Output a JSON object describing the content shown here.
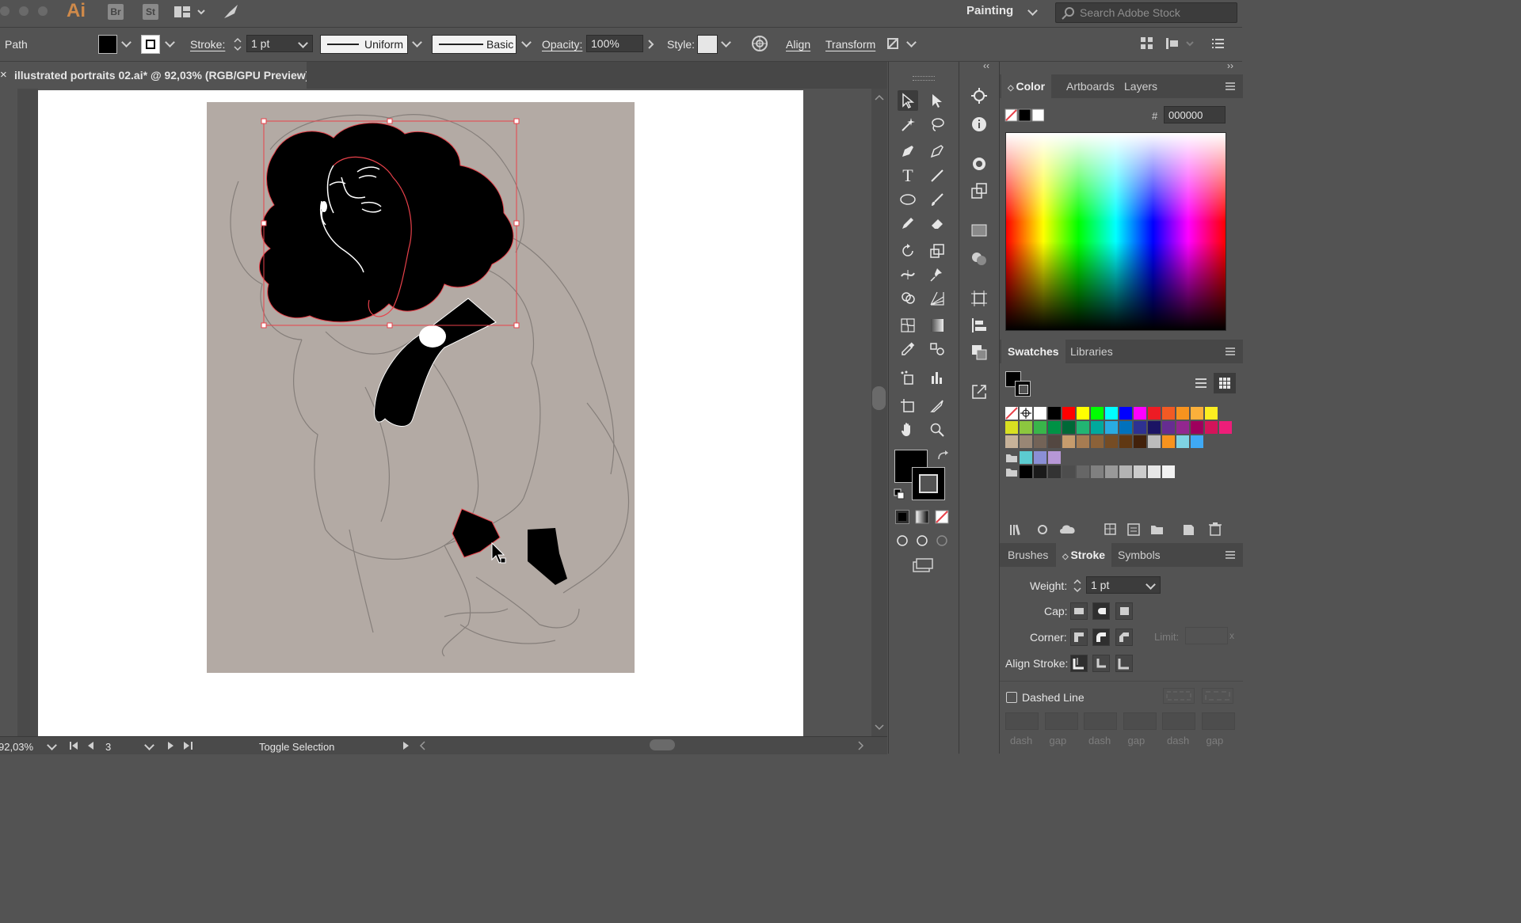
{
  "appbar": {
    "app_logo": "Ai",
    "bridge_label": "Br",
    "stock_label": "St",
    "workspace": "Painting",
    "search_placeholder": "Search Adobe Stock"
  },
  "control_bar": {
    "object_type": "Path",
    "stroke_label": "Stroke:",
    "stroke_weight": "1 pt",
    "profile": "Uniform",
    "brush": "Basic",
    "opacity_label": "Opacity:",
    "opacity_value": "100%",
    "style_label": "Style:",
    "align_label": "Align",
    "transform_label": "Transform"
  },
  "document": {
    "tab_title": "illustrated portraits 02.ai* @ 92,03% (RGB/GPU Preview)"
  },
  "status_bar": {
    "zoom": "92,03%",
    "artboard_number": "3",
    "status_text": "Toggle Selection"
  },
  "color_panel": {
    "tabs": [
      "Color",
      "Artboards",
      "Layers"
    ],
    "hex_label": "#",
    "hex_value": "000000"
  },
  "swatches_panel": {
    "tabs": [
      "Swatches",
      "Libraries"
    ],
    "row1": [
      "#ffffff",
      "#000000",
      "#ff0000",
      "#ffff00",
      "#00ff00",
      "#00ffff",
      "#0000ff",
      "#ff00ff",
      "#ed1c24",
      "#f15a24",
      "#f7931e",
      "#fbb03b",
      "#fcee21"
    ],
    "row2": [
      "#d9e021",
      "#8cc63f",
      "#39b54a",
      "#009245",
      "#006837",
      "#22b573",
      "#00a99d",
      "#29abe2",
      "#0071bc",
      "#2e3192",
      "#1b1464",
      "#662d91",
      "#93278f",
      "#9e005d",
      "#d4145a",
      "#ed1e79"
    ],
    "row3": [
      "#c7b299",
      "#998675",
      "#736357",
      "#534741",
      "#c69c6d",
      "#a67c52",
      "#8c6239",
      "#754c24",
      "#603813",
      "#42210b",
      "#bcbcbc",
      "#f7931e",
      "#7fd3e3",
      "#3fa9f5"
    ],
    "row4": [
      "#5ccbd0",
      "#8b8fd6",
      "#b697d6"
    ],
    "row5": [
      "#000000",
      "#1a1a1a",
      "#333333",
      "#4d4d4d",
      "#666666",
      "#808080",
      "#999999",
      "#b3b3b3",
      "#cccccc",
      "#e6e6e6",
      "#f2f2f2"
    ]
  },
  "stroke_panel": {
    "tabs": [
      "Brushes",
      "Stroke",
      "Symbols"
    ],
    "weight_label": "Weight:",
    "weight_value": "1 pt",
    "cap_label": "Cap:",
    "corner_label": "Corner:",
    "limit_label": "Limit:",
    "align_stroke_label": "Align Stroke:",
    "dashed_line_label": "Dashed Line",
    "dash_gap_labels": [
      "dash",
      "gap",
      "dash",
      "gap",
      "dash",
      "gap"
    ]
  },
  "colors": {
    "ui_background": "#535353",
    "selection_red": "#e8414a",
    "photo_background": "#b3aaa4"
  }
}
